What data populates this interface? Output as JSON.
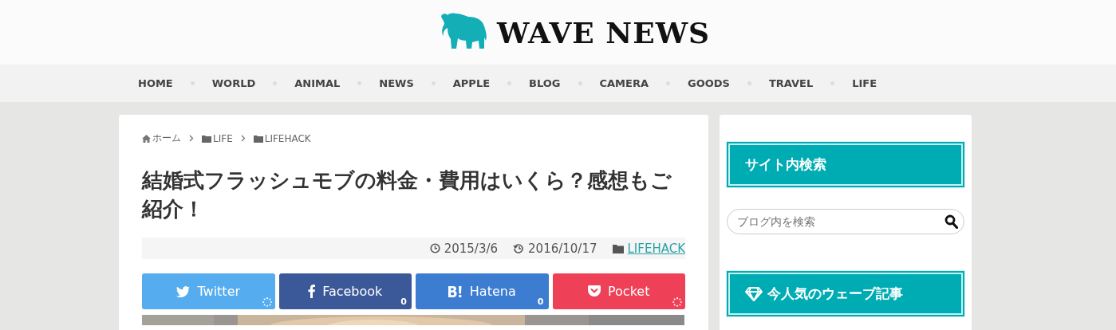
{
  "site": {
    "title": "WAVE NEWS"
  },
  "nav": [
    {
      "label": "HOME"
    },
    {
      "label": "WORLD"
    },
    {
      "label": "ANIMAL"
    },
    {
      "label": "NEWS"
    },
    {
      "label": "APPLE"
    },
    {
      "label": "BLOG"
    },
    {
      "label": "CAMERA"
    },
    {
      "label": "GOODS"
    },
    {
      "label": "TRAVEL"
    },
    {
      "label": "LIFE"
    }
  ],
  "breadcrumb": [
    {
      "kind": "home",
      "label": "ホーム"
    },
    {
      "kind": "folder",
      "label": "LIFE"
    },
    {
      "kind": "folder",
      "label": "LIFEHACK"
    }
  ],
  "article": {
    "title": "結婚式フラッシュモブの料金・費用はいくら？感想もご紹介！",
    "published": "2015/3/6",
    "updated": "2016/10/17",
    "category": "LIFEHACK"
  },
  "share": [
    {
      "kind": "twitter",
      "label": "Twitter",
      "loading": true
    },
    {
      "kind": "facebook",
      "label": "Facebook",
      "count": "0",
      "loading": false
    },
    {
      "kind": "hatena",
      "label": "Hatena",
      "count": "0",
      "loading": false
    },
    {
      "kind": "pocket",
      "label": "Pocket",
      "loading": true
    }
  ],
  "sidebar": {
    "search_heading": "サイト内検索",
    "search": {
      "placeholder": "ブログ内を検索"
    },
    "popular_heading": "今人気のウェーブ記事"
  }
}
